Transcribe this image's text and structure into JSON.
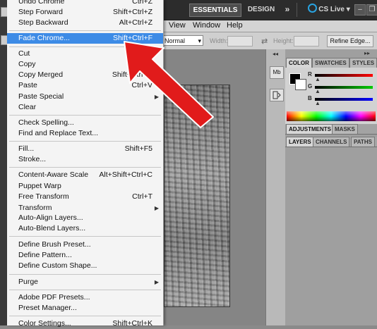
{
  "app": {
    "workspace_essentials": "ESSENTIALS",
    "workspace_design": "DESIGN",
    "more_workspaces": "»",
    "cs_live": "CS Live",
    "cs_live_dropdown": "▾",
    "win_minimize": "–",
    "win_restore": "❐",
    "menu_view": "View",
    "menu_window": "Window",
    "menu_help": "Help"
  },
  "options": {
    "mode_value": "Normal",
    "width_label": "Width:",
    "height_label": "Height:",
    "swap": "⇄",
    "refine_edge": "Refine Edge..."
  },
  "tools": {
    "mini_bridge": "Mb",
    "collapse": "◂◂",
    "collapse_right": "▸▸"
  },
  "panels": {
    "color_tabs": [
      "COLOR",
      "SWATCHES",
      "STYLES"
    ],
    "color_channels": [
      "R",
      "G",
      "B"
    ],
    "mid_tabs": [
      "ADJUSTMENTS",
      "MASKS"
    ],
    "bottom_tabs": [
      "LAYERS",
      "CHANNELS",
      "PATHS"
    ]
  },
  "menu": {
    "items": [
      {
        "label": "Undo Chrome",
        "shortcut": "Ctrl+Z"
      },
      {
        "label": "Step Forward",
        "shortcut": "Shift+Ctrl+Z"
      },
      {
        "label": "Step Backward",
        "shortcut": "Alt+Ctrl+Z"
      },
      {
        "label": "Fade Chrome...",
        "shortcut": "Shift+Ctrl+F"
      },
      {
        "label": "Cut",
        "shortcut": "Ctrl+X"
      },
      {
        "label": "Copy",
        "shortcut": "Ctrl+C"
      },
      {
        "label": "Copy Merged",
        "shortcut": "Shift+Ctrl+C"
      },
      {
        "label": "Paste",
        "shortcut": "Ctrl+V"
      },
      {
        "label": "Paste Special",
        "shortcut": ""
      },
      {
        "label": "Clear",
        "shortcut": ""
      },
      {
        "label": "Check Spelling...",
        "shortcut": ""
      },
      {
        "label": "Find and Replace Text...",
        "shortcut": ""
      },
      {
        "label": "Fill...",
        "shortcut": "Shift+F5"
      },
      {
        "label": "Stroke...",
        "shortcut": ""
      },
      {
        "label": "Content-Aware Scale",
        "shortcut": "Alt+Shift+Ctrl+C"
      },
      {
        "label": "Puppet Warp",
        "shortcut": ""
      },
      {
        "label": "Free Transform",
        "shortcut": "Ctrl+T"
      },
      {
        "label": "Transform",
        "shortcut": ""
      },
      {
        "label": "Auto-Align Layers...",
        "shortcut": ""
      },
      {
        "label": "Auto-Blend Layers...",
        "shortcut": ""
      },
      {
        "label": "Define Brush Preset...",
        "shortcut": ""
      },
      {
        "label": "Define Pattern...",
        "shortcut": ""
      },
      {
        "label": "Define Custom Shape...",
        "shortcut": ""
      },
      {
        "label": "Purge",
        "shortcut": ""
      },
      {
        "label": "Adobe PDF Presets...",
        "shortcut": ""
      },
      {
        "label": "Preset Manager...",
        "shortcut": ""
      },
      {
        "label": "Color Settings...",
        "shortcut": "Shift+Ctrl+K"
      }
    ],
    "submenu_arrow": "▶"
  },
  "colors": {
    "highlight": "#3d8be6",
    "arrow": "#e11b1b",
    "accent_cs_live": "#29a3e0"
  }
}
